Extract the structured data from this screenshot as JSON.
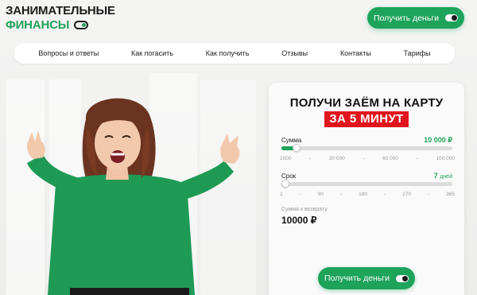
{
  "logo": {
    "line1": "ЗАНИМАТЕЛЬНЫЕ",
    "line2": "ФИНАНСЫ"
  },
  "header": {
    "cta_label": "Получить деньги"
  },
  "nav": {
    "items": [
      "Вопросы и ответы",
      "Как погасить",
      "Как получить",
      "Отзывы",
      "Контакты",
      "Тарифы"
    ]
  },
  "form": {
    "title": "ПОЛУЧИ ЗАЁМ НА КАРТУ",
    "highlight": "ЗА 5 МИНУТ",
    "amount": {
      "label": "Сумма",
      "value": "10 000 ₽",
      "level": 0.09,
      "ticks": [
        "1000",
        "-",
        "30 000",
        "-",
        "60 000",
        "-",
        "100 000"
      ]
    },
    "term": {
      "label": "Срок",
      "value": "7",
      "unit": "дней",
      "level": 0.02,
      "ticks": [
        "1",
        "-",
        "90",
        "-",
        "180",
        "-",
        "270",
        "-",
        "365"
      ]
    },
    "return_label": "Сумма к возврату",
    "return_value": "10000 ₽",
    "cta_label": "Получить деньги"
  },
  "colors": {
    "accent": "#1ea35b",
    "highlight": "#e0151d"
  },
  "icons": {
    "toggle": "toggle-icon"
  }
}
